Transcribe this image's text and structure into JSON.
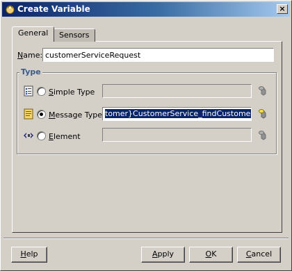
{
  "window": {
    "title": "Create Variable"
  },
  "tabs": [
    {
      "label": "General",
      "active": true
    },
    {
      "label": "Sensors",
      "active": false
    }
  ],
  "name": {
    "label_mnemonic": "N",
    "label_rest": "ame:",
    "value": "customerServiceRequest"
  },
  "type_group": {
    "legend": "Type",
    "options": [
      {
        "mnemonic": "S",
        "rest": "imple Type",
        "selected": false,
        "value": "",
        "icon": "simple-type-icon"
      },
      {
        "mnemonic": "M",
        "rest": "essage Type",
        "selected": true,
        "value": "tomer}CustomerService_findCustomerById",
        "icon": "message-type-icon"
      },
      {
        "mnemonic": "E",
        "rest": "lement",
        "selected": false,
        "value": "",
        "icon": "element-icon"
      }
    ]
  },
  "buttons": {
    "help_mnemonic": "H",
    "help_rest": "elp",
    "apply_mnemonic": "A",
    "apply_rest": "pply",
    "ok_mnemonic": "O",
    "ok_rest": "K",
    "cancel_mnemonic": "C",
    "cancel_rest": "ancel"
  },
  "colors": {
    "titlebar_start": "#0a246a",
    "titlebar_end": "#a6caf0",
    "legend": "#3a5a8c",
    "selection": "#0a246a"
  }
}
